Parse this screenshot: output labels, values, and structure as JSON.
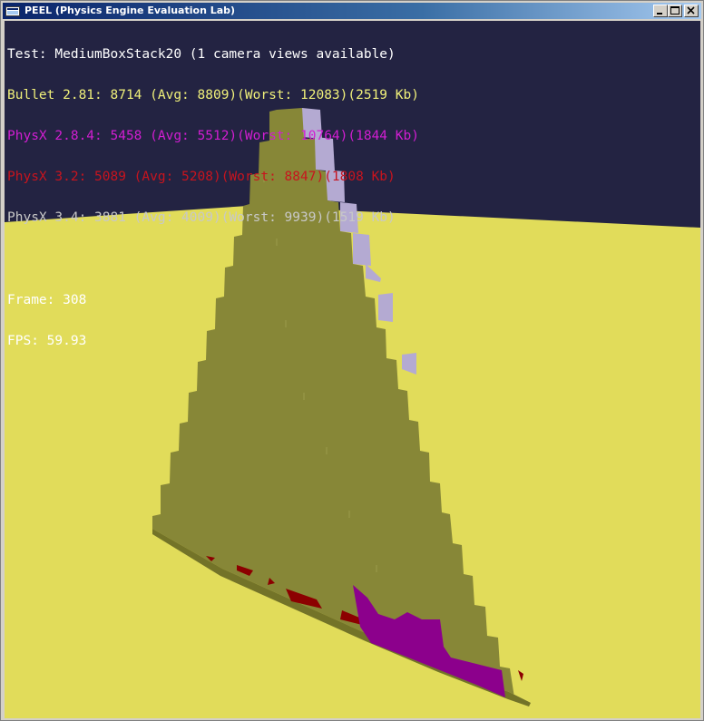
{
  "window": {
    "title": "PEEL (Physics Engine Evaluation Lab)",
    "icon": "app-icon",
    "buttons": {
      "minimize": "minimize-icon",
      "maximize": "maximize-icon",
      "close": "close-icon"
    }
  },
  "stats": {
    "test": "Test: MediumBoxStack20 (1 camera views available)",
    "engines": [
      {
        "text": "Bullet 2.81: 8714 (Avg: 8809)(Worst: 12083)(2519 Kb)",
        "color": "#f0f07a"
      },
      {
        "text": "PhysX 2.8.4: 5458 (Avg: 5512)(Worst: 10764)(1844 Kb)",
        "color": "#d21ed2"
      },
      {
        "text": "PhysX 3.2: 5089 (Avg: 5208)(Worst: 8847)(1808 Kb)",
        "color": "#c8141e"
      },
      {
        "text": "PhysX 3.4: 3881 (Avg: 4009)(Worst: 9939)(1519 Kb)",
        "color": "#c8c8c8"
      }
    ],
    "frame": "Frame: 308",
    "fps": "FPS: 59.93"
  },
  "scene": {
    "colors": {
      "sky": "#232342",
      "ground": "#e1dc5a",
      "boxes_bullet": "#878737",
      "boxes_physx34": "#b4aad2",
      "boxes_physx284": "#8c008c",
      "boxes_physx32": "#8c0000",
      "slab_edge": "#737328"
    }
  }
}
